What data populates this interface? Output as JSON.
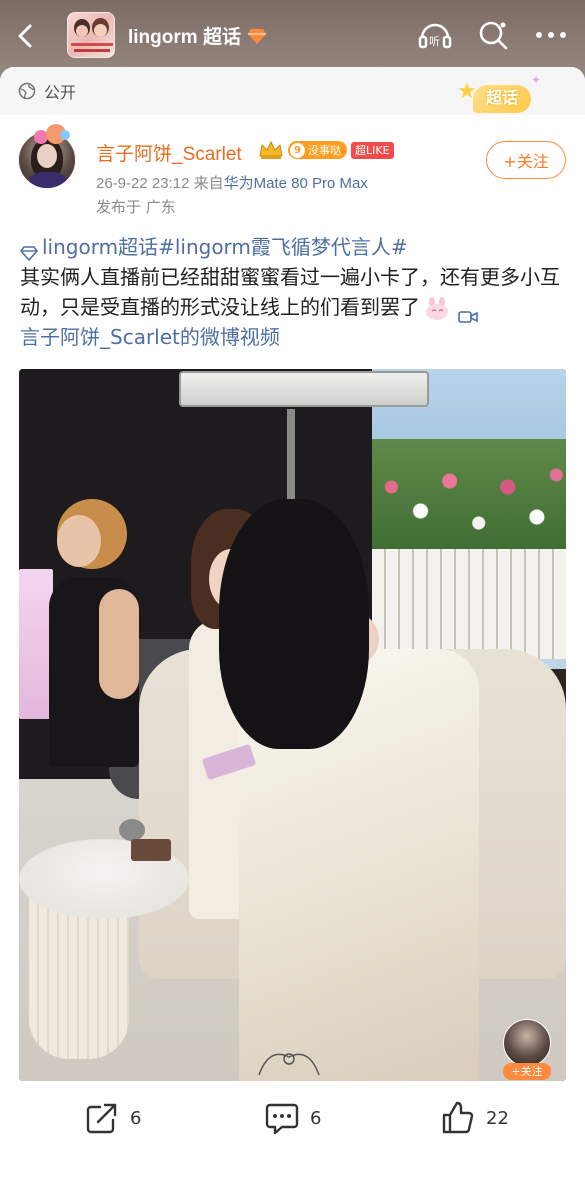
{
  "header": {
    "title": "lingorm 超话",
    "icons": [
      "back-icon",
      "gem-icon",
      "listen-icon",
      "search-icon",
      "more-icon"
    ],
    "listen_label": "听"
  },
  "visibility": {
    "label": "公开",
    "icon": "globe-icon"
  },
  "chaohua_badge": {
    "label": "超话"
  },
  "post": {
    "author": {
      "name": "言子阿饼_Scarlet",
      "level": "9",
      "level_tag": "没事哒",
      "like_tag": "超LIKE"
    },
    "time": "26-9-22 23:12",
    "source_prefix": "来自",
    "device": "华为Mate 80 Pro Max",
    "location": "发布于 广东",
    "follow_label": "+关注",
    "topic_text": "lingorm超话#lingorm霞飞循梦代言人#",
    "body_text": "其实俩人直播前已经甜甜蜜蜜看过一遍小卡了，还有更多小互动，只是受直播的形式没让线上的们看到罢了",
    "video_link": "言子阿饼_Scarlet的微博视频"
  },
  "video": {
    "overlay_follow_label": "+关注"
  },
  "actions": {
    "share_count": "6",
    "comment_count": "6",
    "like_count": "22"
  },
  "colors": {
    "accent_orange": "#ff7a22",
    "link_blue": "#4f6fa4",
    "author_orange": "#ea6c1f"
  }
}
